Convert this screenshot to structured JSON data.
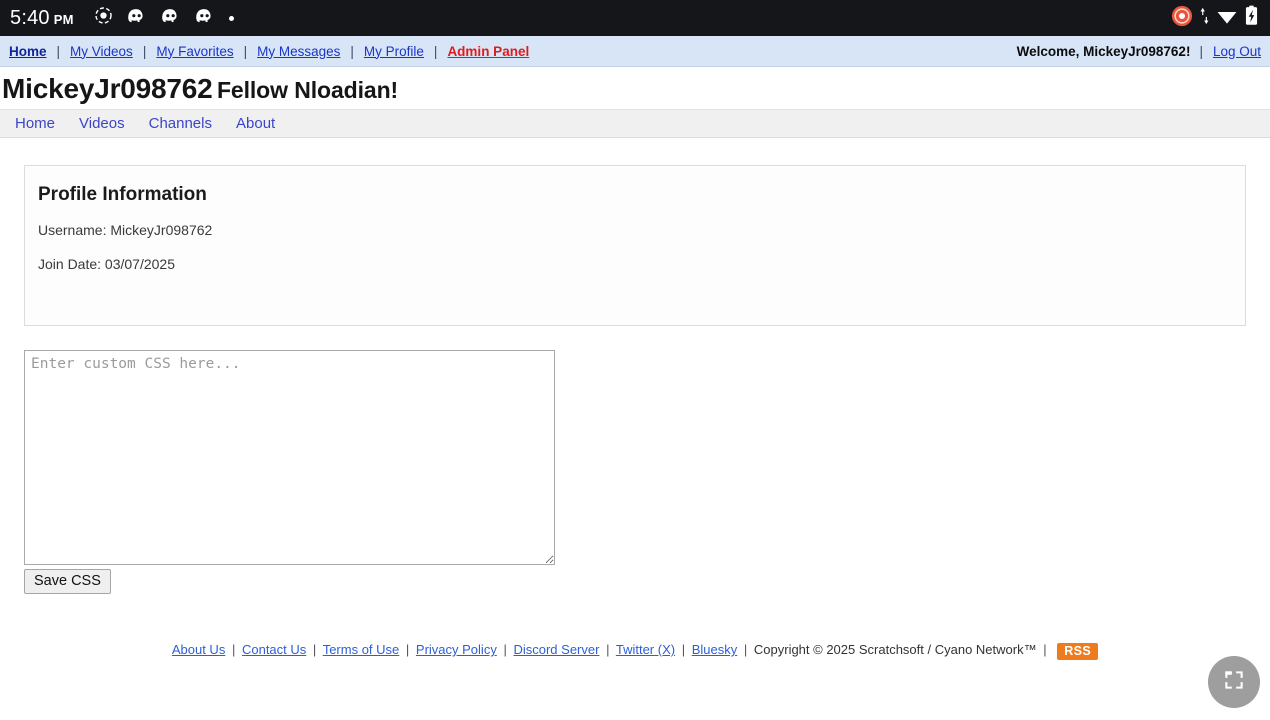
{
  "status_bar": {
    "time": "5:40",
    "ampm": "PM",
    "left_icons": [
      "screen-record-icon",
      "discord-icon",
      "discord-icon",
      "discord-icon",
      "dot-icon"
    ],
    "right_icons": [
      "recording-active-icon",
      "data-transfer-icon",
      "wifi-icon",
      "battery-charging-icon"
    ],
    "background": "#15161a"
  },
  "top_nav": {
    "links": [
      {
        "label": "Home",
        "style": "active"
      },
      {
        "label": "My Videos",
        "style": "normal"
      },
      {
        "label": "My Favorites",
        "style": "normal"
      },
      {
        "label": "My Messages",
        "style": "normal"
      },
      {
        "label": "My Profile",
        "style": "normal"
      },
      {
        "label": "Admin Panel",
        "style": "admin"
      }
    ],
    "separator": "|",
    "welcome": "Welcome, MickeyJr098762!",
    "logout_label": "Log Out",
    "background": "#d7e5f7",
    "link_color": "#1a35c8",
    "admin_color": "#e01b1b"
  },
  "heading": {
    "username": "MickeyJr098762",
    "tagline": "Fellow Nloadian!"
  },
  "sub_nav": {
    "items": [
      "Home",
      "Videos",
      "Channels",
      "About"
    ],
    "background": "#f0f0f0",
    "link_color": "#3b45c8"
  },
  "profile_card": {
    "title": "Profile Information",
    "username_line": "Username: MickeyJr098762",
    "join_date_line": "Join Date: 03/07/2025"
  },
  "custom_css": {
    "placeholder": "Enter custom CSS here...",
    "value": "",
    "save_label": "Save CSS"
  },
  "footer": {
    "links": [
      "About Us",
      "Contact Us",
      "Terms of Use",
      "Privacy Policy",
      "Discord Server",
      "Twitter (X)",
      "Bluesky"
    ],
    "separator": "|",
    "copyright": "Copyright © 2025 Scratchsoft / Cyano Network™",
    "rss_label": "RSS",
    "rss_color": "#ee7b1e"
  },
  "fab": {
    "icon": "collapse-icon",
    "background": "#9e9e9e"
  }
}
